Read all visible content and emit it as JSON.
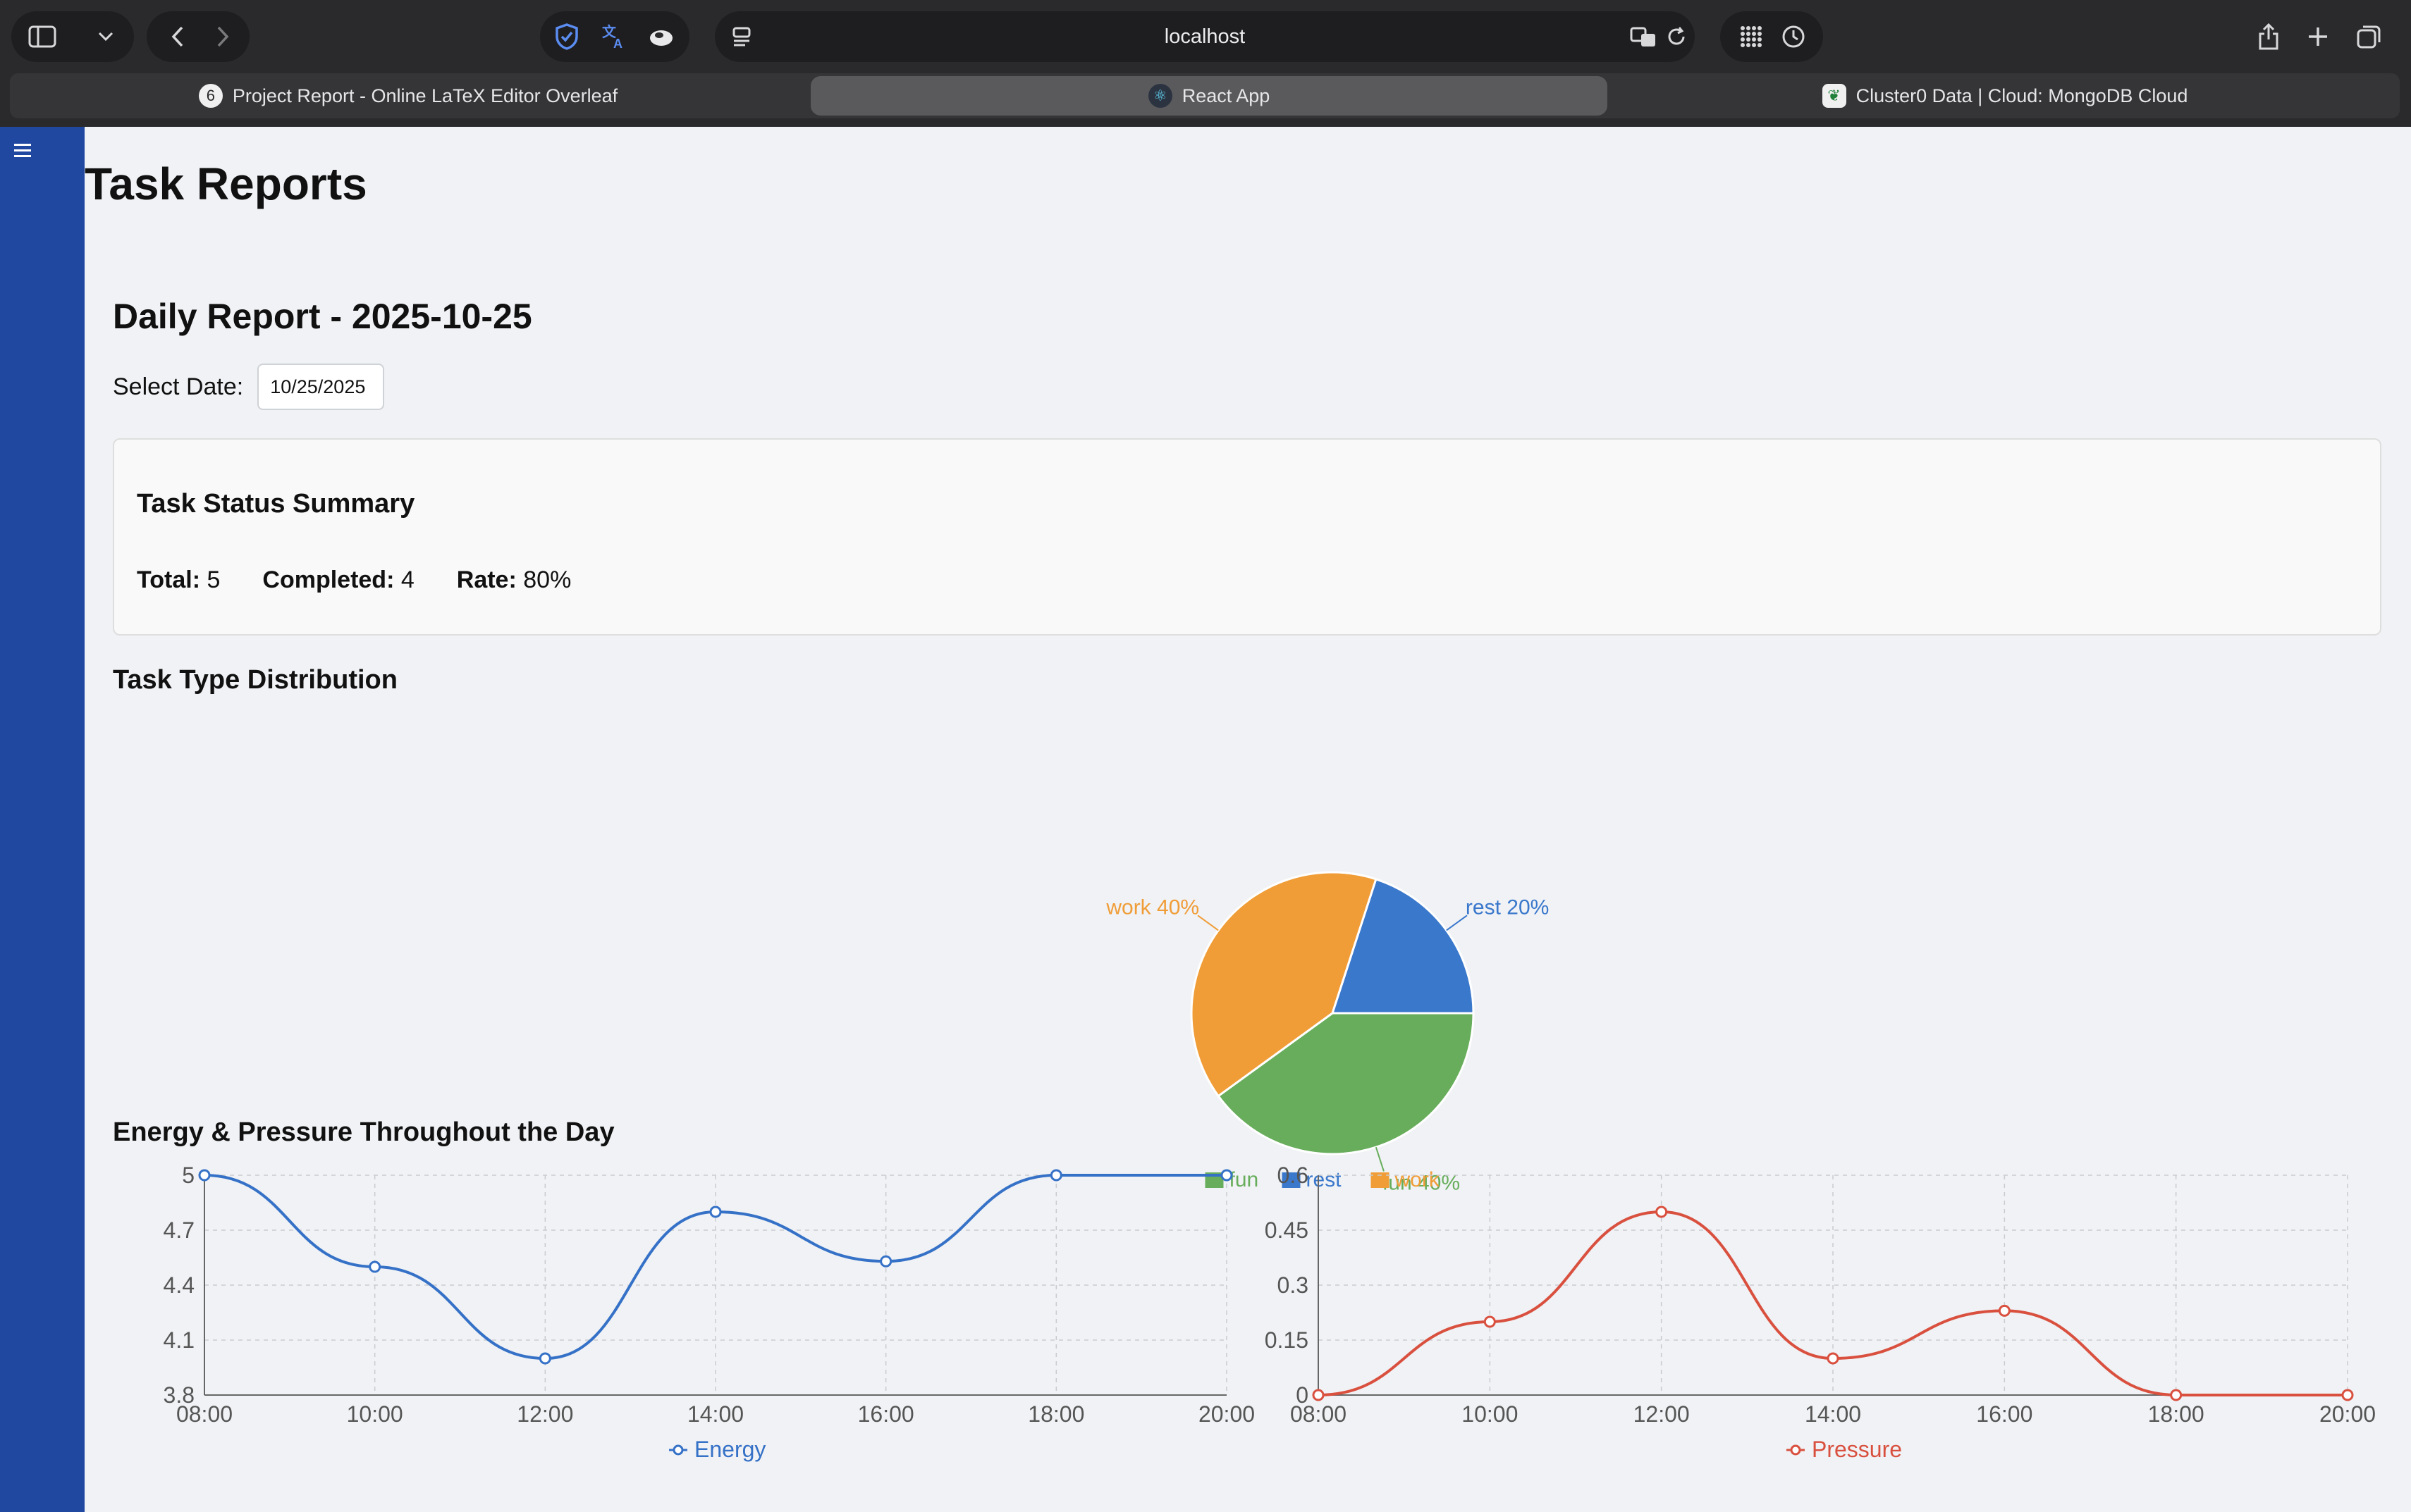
{
  "browser": {
    "url": "localhost",
    "tabs": [
      {
        "label": "Project Report - Online LaTeX Editor Overleaf"
      },
      {
        "label": "React App"
      },
      {
        "label": "Cluster0 Data | Cloud: MongoDB Cloud"
      }
    ]
  },
  "page": {
    "title": "Task Reports",
    "daily_title": "Daily Report - 2025-10-25",
    "select_date_label": "Select Date:",
    "date_value": "10/25/2025"
  },
  "summary": {
    "title": "Task Status Summary",
    "total_label": "Total:",
    "total_value": "5",
    "completed_label": "Completed:",
    "completed_value": "4",
    "rate_label": "Rate:",
    "rate_value": "80%"
  },
  "sections": {
    "distribution_title": "Task Type Distribution",
    "energy_title": "Energy & Pressure Throughout the Day"
  },
  "colors": {
    "fun": "#67ad5b",
    "rest": "#3a78cc",
    "work": "#f09d38",
    "energy": "#3571c7",
    "pressure": "#d9503f",
    "sidebar": "#2148a0"
  },
  "chart_data": [
    {
      "type": "pie",
      "slices": [
        {
          "label": "rest",
          "value": 20,
          "display": "rest 20%"
        },
        {
          "label": "fun",
          "value": 40,
          "display": "fun 40%"
        },
        {
          "label": "work",
          "value": 40,
          "display": "work 40%"
        }
      ],
      "legend": [
        "fun",
        "rest",
        "work"
      ],
      "legend_position": "bottom"
    },
    {
      "type": "line",
      "x": [
        "08:00",
        "10:00",
        "12:00",
        "14:00",
        "16:00",
        "18:00",
        "20:00"
      ],
      "series": [
        {
          "name": "Energy",
          "values": [
            5,
            4.5,
            4.0,
            4.8,
            4.53,
            5,
            5
          ]
        }
      ],
      "ylim": [
        3.8,
        5
      ],
      "yticks": [
        "3.8",
        "4.1",
        "4.4",
        "4.7",
        "5"
      ],
      "grid": true,
      "legend_position": "bottom"
    },
    {
      "type": "line",
      "x": [
        "08:00",
        "10:00",
        "12:00",
        "14:00",
        "16:00",
        "18:00",
        "20:00"
      ],
      "series": [
        {
          "name": "Pressure",
          "values": [
            0,
            0.2,
            0.5,
            0.1,
            0.23,
            0,
            0
          ]
        }
      ],
      "ylim": [
        0,
        0.6
      ],
      "yticks": [
        "0",
        "0.15",
        "0.3",
        "0.45",
        "0.6"
      ],
      "grid": true,
      "legend_position": "bottom"
    }
  ]
}
